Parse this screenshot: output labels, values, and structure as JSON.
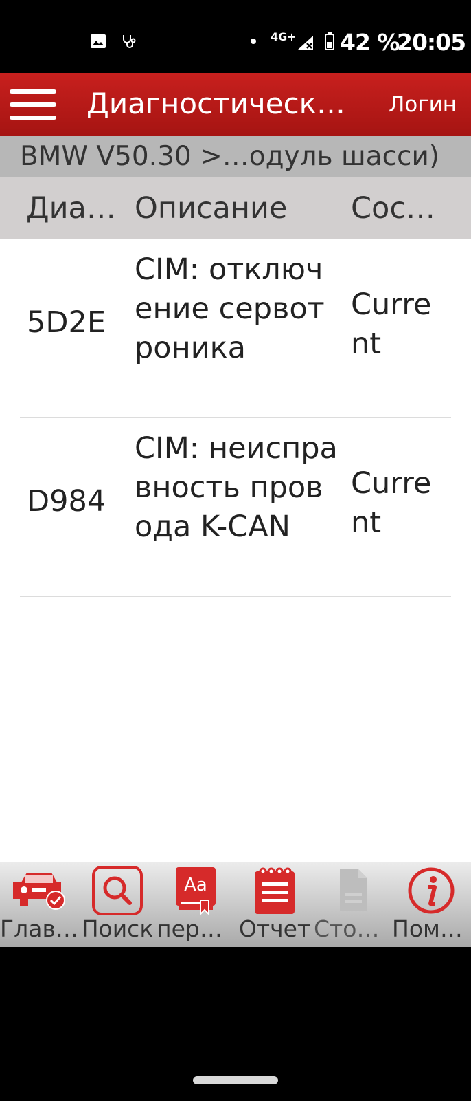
{
  "status_bar": {
    "network": "4G+",
    "battery": "42 %",
    "time": "20:05",
    "icons": [
      "gallery-icon",
      "stethoscope-icon",
      "dot-icon",
      "signal-icon",
      "battery-icon"
    ]
  },
  "app_bar": {
    "title": "Диагностический…",
    "login_label": "Логин",
    "menu_icon": "hamburger-menu-icon",
    "color": "#b51816"
  },
  "breadcrumb": "BMW V50.30 >…одуль шасси)",
  "table": {
    "headers": [
      "Диа…",
      "Описание",
      "Сос…"
    ],
    "rows": [
      {
        "code": "5D2E",
        "description": "CIM: отключение сервотроника",
        "status": "Current"
      },
      {
        "code": "D984",
        "description": "CIM: неисправность провода K-CAN",
        "status": "Current"
      }
    ]
  },
  "toolbar": {
    "items": [
      {
        "label": "Глав…",
        "icon": "car-check-icon",
        "enabled": true
      },
      {
        "label": "Поиск",
        "icon": "search-icon",
        "enabled": true
      },
      {
        "label": "пере…",
        "icon": "translate-icon",
        "enabled": true
      },
      {
        "label": "Отчет",
        "icon": "report-icon",
        "enabled": true
      },
      {
        "label": "Стоп-…",
        "icon": "freeze-frame-icon",
        "enabled": false
      },
      {
        "label": "Помо…",
        "icon": "info-icon",
        "enabled": true
      }
    ],
    "accent": "#d62a2a"
  }
}
